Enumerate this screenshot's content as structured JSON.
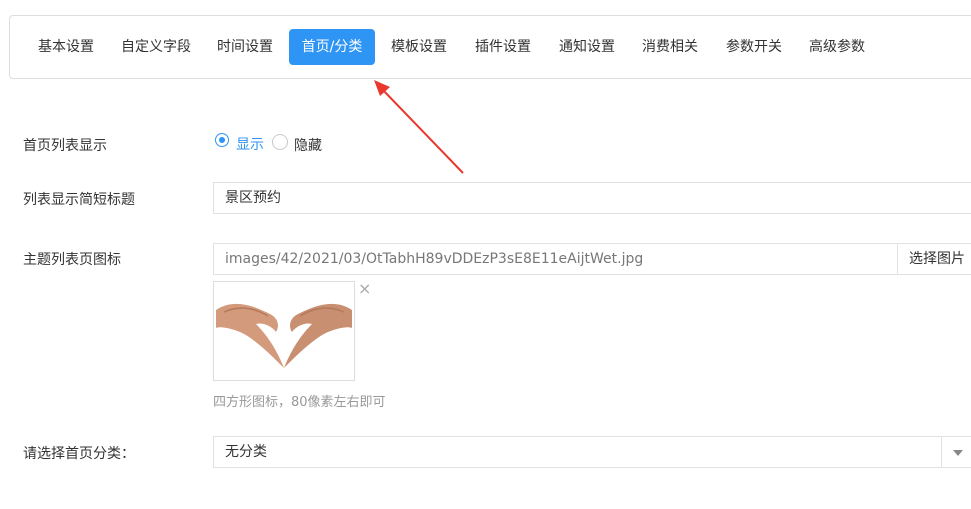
{
  "tabs": [
    {
      "label": "基本设置"
    },
    {
      "label": "自定义字段"
    },
    {
      "label": "时间设置"
    },
    {
      "label": "首页/分类"
    },
    {
      "label": "模板设置"
    },
    {
      "label": "插件设置"
    },
    {
      "label": "通知设置"
    },
    {
      "label": "消费相关"
    },
    {
      "label": "参数开关"
    },
    {
      "label": "高级参数"
    }
  ],
  "active_tab": "首页/分类",
  "form": {
    "list_display": {
      "label": "首页列表显示",
      "options": [
        "显示",
        "隐藏"
      ],
      "selected": "显示"
    },
    "short_title": {
      "label": "列表显示简短标题",
      "value": "景区预约"
    },
    "icon": {
      "label": "主题列表页图标",
      "path": "images/42/2021/03/OtTabhH89vDDEzP3sE8E11eAijtWet.jpg",
      "button": "选择图片",
      "remove": "×",
      "hint": "四方形图标，80像素左右即可"
    },
    "category": {
      "label": "请选择首页分类：",
      "selected": "无分类"
    }
  },
  "colors": {
    "accent": "#2f95f4",
    "annotation": "#e8382f"
  }
}
